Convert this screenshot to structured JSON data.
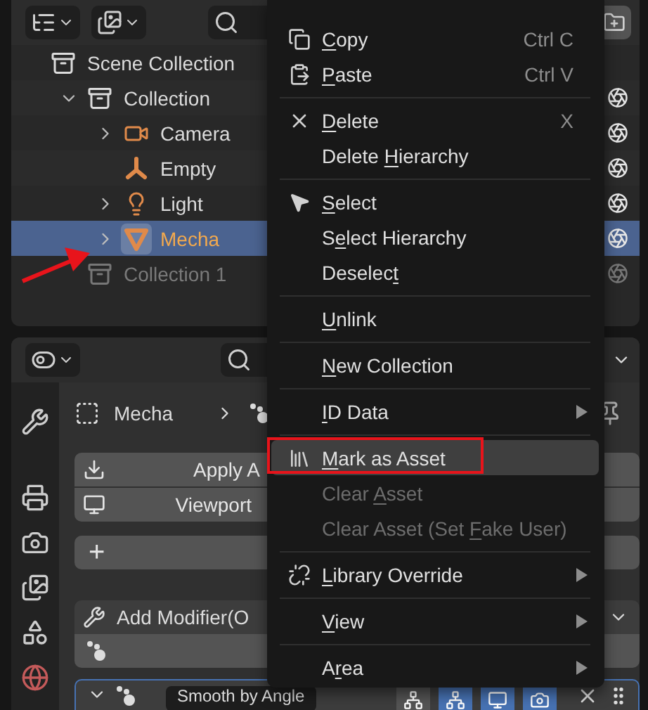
{
  "outliner": {
    "rows": [
      {
        "label": "Scene Collection",
        "kind": "scene",
        "selected": false,
        "disabled": false,
        "children": [
          {
            "label": "Collection",
            "kind": "collection",
            "expanded": true,
            "selected": false,
            "disabled": false,
            "children": [
              {
                "label": "Camera",
                "kind": "camera",
                "expanded": false,
                "selected": false,
                "disabled": false
              },
              {
                "label": "Empty",
                "kind": "empty",
                "selected": false,
                "disabled": false
              },
              {
                "label": "Light",
                "kind": "light",
                "expanded": false,
                "selected": false,
                "disabled": false
              },
              {
                "label": "Mecha",
                "kind": "mesh",
                "expanded": false,
                "selected": true,
                "disabled": false
              }
            ]
          },
          {
            "label": "Collection 1",
            "kind": "collection",
            "selected": false,
            "disabled": true
          }
        ]
      }
    ]
  },
  "properties": {
    "object_name": "Mecha",
    "buttons": [
      {
        "label": "Apply A",
        "kind": "download"
      },
      {
        "label": "Viewport",
        "kind": "monitor"
      }
    ],
    "add_button": "+",
    "add_modifier": "Add Modifier(O",
    "modifier": {
      "name": "Smooth by Angle",
      "expanded": true
    }
  },
  "context_menu": {
    "items": [
      {
        "kind": "item",
        "label": {
          "key": "C",
          "after": "opy"
        },
        "shortcut": "Ctrl C",
        "submenu": false,
        "disabled": false,
        "selected": false
      },
      {
        "kind": "item",
        "label": {
          "key": "P",
          "after": "aste"
        },
        "shortcut": "Ctrl V",
        "submenu": false,
        "disabled": false,
        "selected": false
      },
      {
        "kind": "separator"
      },
      {
        "kind": "item",
        "label": {
          "key": "D",
          "after": "elete"
        },
        "shortcut": "X",
        "submenu": false,
        "disabled": false,
        "selected": false
      },
      {
        "kind": "item",
        "label": {
          "before": "Delete ",
          "key": "H",
          "after": "ierarchy"
        },
        "submenu": false,
        "disabled": false,
        "selected": false
      },
      {
        "kind": "separator"
      },
      {
        "kind": "item",
        "label": {
          "key": "S",
          "after": "elect"
        },
        "submenu": false,
        "disabled": false,
        "selected": false
      },
      {
        "kind": "item",
        "label": {
          "before": "S",
          "key": "e",
          "after": "lect Hierarchy"
        },
        "submenu": false,
        "disabled": false,
        "selected": false
      },
      {
        "kind": "item",
        "label": {
          "before": "Deselec",
          "key": "t"
        },
        "submenu": false,
        "disabled": false,
        "selected": false
      },
      {
        "kind": "separator"
      },
      {
        "kind": "item",
        "label": {
          "key": "U",
          "after": "nlink"
        },
        "submenu": false,
        "disabled": false,
        "selected": false
      },
      {
        "kind": "separator"
      },
      {
        "kind": "item",
        "label": {
          "key": "N",
          "after": "ew Collection"
        },
        "submenu": false,
        "disabled": false,
        "selected": false
      },
      {
        "kind": "separator"
      },
      {
        "kind": "item",
        "label": {
          "key": "I",
          "after": "D Data"
        },
        "submenu": true,
        "disabled": false,
        "selected": false
      },
      {
        "kind": "separator"
      },
      {
        "kind": "item",
        "label": {
          "key": "M",
          "after": "ark as Asset"
        },
        "submenu": false,
        "disabled": false,
        "selected": true
      },
      {
        "kind": "item",
        "label": {
          "before": "Clear ",
          "key": "A",
          "after": "sset"
        },
        "submenu": false,
        "disabled": true,
        "selected": false
      },
      {
        "kind": "item",
        "label": {
          "before": "Clear Asset (Set ",
          "key": "F",
          "after": "ake User)"
        },
        "submenu": false,
        "disabled": true,
        "selected": false
      },
      {
        "kind": "separator"
      },
      {
        "kind": "item",
        "label": {
          "key": "L",
          "after": "ibrary Override"
        },
        "submenu": true,
        "disabled": false,
        "selected": false
      },
      {
        "kind": "separator"
      },
      {
        "kind": "item",
        "label": {
          "key": "V",
          "after": "iew"
        },
        "submenu": true,
        "disabled": false,
        "selected": false
      },
      {
        "kind": "separator"
      },
      {
        "kind": "item",
        "label": {
          "before": "A",
          "key": "r",
          "after": "ea"
        },
        "submenu": true,
        "disabled": false,
        "selected": false
      }
    ]
  }
}
